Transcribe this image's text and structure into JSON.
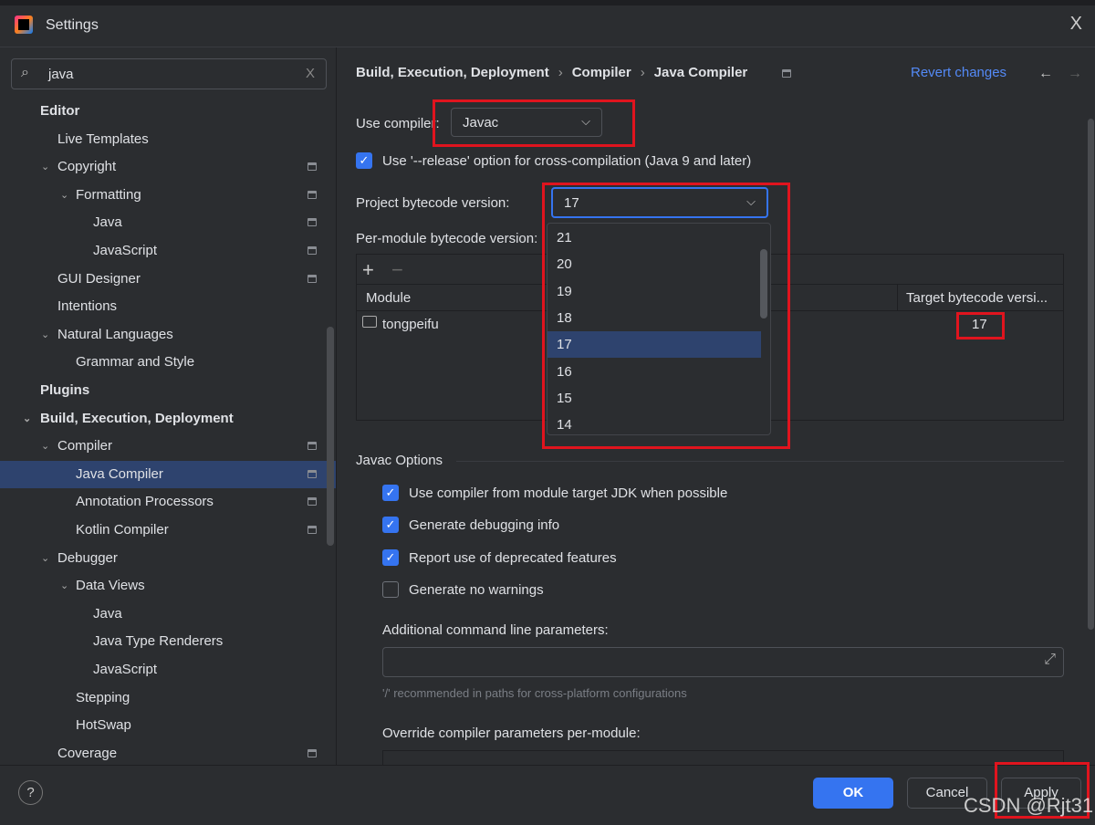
{
  "window": {
    "title": "Settings",
    "close": "X"
  },
  "search": {
    "value": "java",
    "clear": "X"
  },
  "tree": [
    {
      "label": "Editor",
      "level": 0,
      "bold": true
    },
    {
      "label": "Live Templates",
      "level": 1
    },
    {
      "label": "Copyright",
      "level": 1,
      "chevron": true,
      "icon": true
    },
    {
      "label": "Formatting",
      "level": 2,
      "chevron": true,
      "icon": true
    },
    {
      "label": "Java",
      "level": 3,
      "icon": true
    },
    {
      "label": "JavaScript",
      "level": 3,
      "icon": true
    },
    {
      "label": "GUI Designer",
      "level": 1,
      "icon": true
    },
    {
      "label": "Intentions",
      "level": 1
    },
    {
      "label": "Natural Languages",
      "level": 1,
      "chevron": true
    },
    {
      "label": "Grammar and Style",
      "level": 2
    },
    {
      "label": "Plugins",
      "level": 0,
      "bold": true
    },
    {
      "label": "Build, Execution, Deployment",
      "level": 0,
      "bold": true,
      "chevron": true
    },
    {
      "label": "Compiler",
      "level": 1,
      "chevron": true,
      "icon": true
    },
    {
      "label": "Java Compiler",
      "level": 2,
      "icon": true,
      "selected": true
    },
    {
      "label": "Annotation Processors",
      "level": 2,
      "icon": true
    },
    {
      "label": "Kotlin Compiler",
      "level": 2,
      "icon": true
    },
    {
      "label": "Debugger",
      "level": 1,
      "chevron": true
    },
    {
      "label": "Data Views",
      "level": 2,
      "chevron": true
    },
    {
      "label": "Java",
      "level": 3
    },
    {
      "label": "Java Type Renderers",
      "level": 3
    },
    {
      "label": "JavaScript",
      "level": 3
    },
    {
      "label": "Stepping",
      "level": 2
    },
    {
      "label": "HotSwap",
      "level": 2
    },
    {
      "label": "Coverage",
      "level": 1,
      "icon": true
    }
  ],
  "breadcrumb": [
    "Build, Execution, Deployment",
    "Compiler",
    "Java Compiler"
  ],
  "breadcrumb_sep": "›",
  "revert": "Revert changes",
  "nav": {
    "back": "←",
    "forward": "→"
  },
  "use_compiler": {
    "label": "Use compiler:",
    "value": "Javac"
  },
  "release_option": {
    "label": "Use '--release' option for cross-compilation (Java 9 and later)",
    "checked": true
  },
  "bytecode": {
    "label": "Project bytecode version:",
    "value": "17",
    "options": [
      "21",
      "20",
      "19",
      "18",
      "17",
      "16",
      "15",
      "14"
    ],
    "selected": "17"
  },
  "per_module": {
    "label": "Per-module bytecode version:",
    "add": "+",
    "remove": "−",
    "columns": [
      "Module",
      "Target bytecode versi..."
    ],
    "rows": [
      {
        "module": "tongpeifu",
        "target": "17"
      }
    ]
  },
  "javac": {
    "section": "Javac Options",
    "options": [
      {
        "label": "Use compiler from module target JDK when possible",
        "checked": true
      },
      {
        "label": "Generate debugging info",
        "checked": true
      },
      {
        "label": "Report use of deprecated features",
        "checked": true
      },
      {
        "label": "Generate no warnings",
        "checked": false
      }
    ],
    "additional_label": "Additional command line parameters:",
    "additional_value": "",
    "hint": "'/' recommended in paths for cross-platform configurations",
    "override_label": "Override compiler parameters per-module:"
  },
  "footer": {
    "help": "?",
    "ok": "OK",
    "cancel": "Cancel",
    "apply": "Apply"
  },
  "watermark": "CSDN @Rjt31",
  "colors": {
    "accent": "#3574f0",
    "selection": "#2e436e",
    "highlight_box": "#e0141e",
    "link": "#548af7"
  }
}
